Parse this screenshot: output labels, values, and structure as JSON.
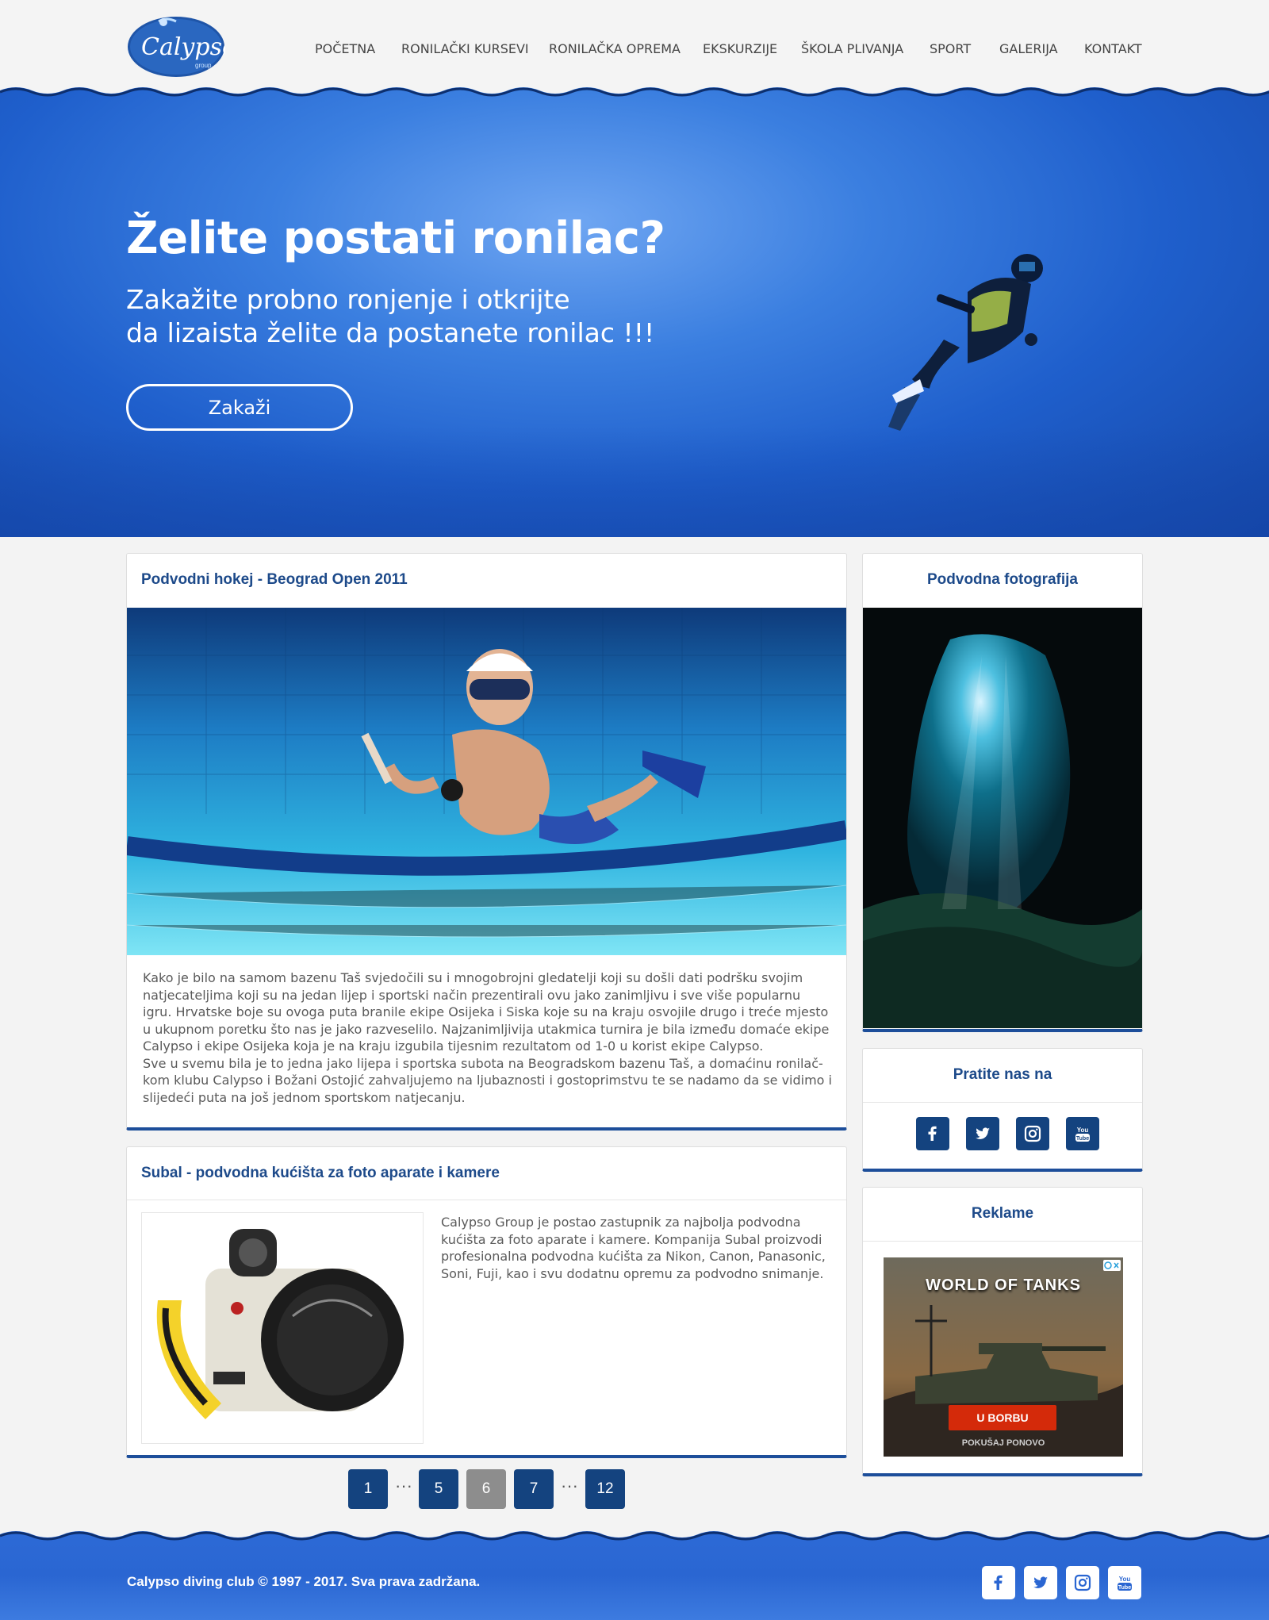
{
  "brand": {
    "logo_text": "Calypso",
    "logo_sub": "group"
  },
  "nav": [
    {
      "label": "POČETNA"
    },
    {
      "label": "RONILAČKI KURSEVI"
    },
    {
      "label": "RONILAČKA OPREMA"
    },
    {
      "label": "EKSKURZIJE"
    },
    {
      "label": "ŠKOLA PLIVANJA"
    },
    {
      "label": "SPORT"
    },
    {
      "label": "GALERIJA"
    },
    {
      "label": "KONTAKT"
    }
  ],
  "hero": {
    "title": "Želite postati ronilac?",
    "subtitle_line1": "Zakažite probno ronjenje i otkrijte",
    "subtitle_line2": "da lizaista želite da postanete ronilac !!!",
    "button": "Zakaži"
  },
  "article1": {
    "title": "Podvodni hokej - Beograd Open 2011",
    "paragraph1": "Kako je bilo na samom bazenu Taš svjedočili su i mnogobrojni gledatelji koji su došli dati podršku svojim natjecateljima koji su na jedan lijep i sportski način prezentirali ovu jako zanimljivu i sve više popularnu igru. Hrvatske boje su ovoga puta branile ekipe Osijeka i Siska koje su na kraju osvojile drugo i treće mjesto u ukupnom poretku što nas je jako razveselilo. Najzanimljivija utakmica turnira je bila između domaće ekipe Calypso i ekipe Osijeka koja je na kraju izgubila tijesnim rezultatom od 1-0 u korist ekipe Calypso.",
    "paragraph2": "Sve u svemu bila je to jedna jako lijepa i sportska subota na Beogradskom bazenu Taš, a domaćinu ronilač-kom klubu Calypso i Božani Ostojić zahvaljujemo na ljubaznosti i gostoprimstvu te se nadamo da se vidimo i slijedeći puta na još jednom sportskom natjecanju."
  },
  "article2": {
    "title": "Subal - podvodna kućišta za foto aparate i kamere",
    "text": "Calypso Group je postao zastupnik za najbolja podvodna kućišta za foto aparate i kamere. Kompanija Subal proizvodi profesionalna podvodna kućišta za Nikon, Canon, Panasonic, Soni, Fuji, kao i svu dodatnu opremu za podvodno snimanje."
  },
  "sidebar": {
    "photo_title": "Podvodna fotografija",
    "follow_title": "Pratite nas na",
    "ads_title": "Reklame",
    "ad": {
      "game_title": "WORLD OF TANKS",
      "cta": "U BORBU",
      "retry": "POKUŠAJ PONOVO"
    }
  },
  "social_icons": [
    "facebook-icon",
    "twitter-icon",
    "instagram-icon",
    "youtube-icon"
  ],
  "pagination": [
    {
      "label": "1"
    },
    {
      "label": "5"
    },
    {
      "label": "6",
      "active": true
    },
    {
      "label": "7"
    },
    {
      "label": "12"
    }
  ],
  "pagination_ellipsis": "···",
  "footer": {
    "copyright": "Calypso diving club © 1997 - 2017. Sva prava zadržana."
  },
  "colors": {
    "brand_blue": "#1d4a8a",
    "accent_bar": "#1d4e9a",
    "button_blue": "#14437f",
    "active_page": "#8d8d8d"
  }
}
